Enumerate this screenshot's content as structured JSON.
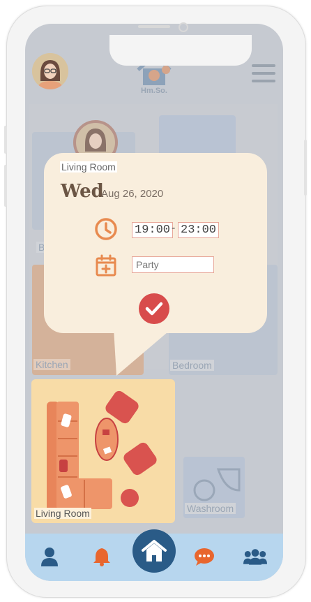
{
  "app": {
    "logo_text": "Hm.So."
  },
  "rooms": [
    {
      "label": "B"
    },
    {
      "label": "Kitchen"
    },
    {
      "label": "Bedroom"
    },
    {
      "label": "Washroom"
    }
  ],
  "living_room": {
    "label": "Living Room"
  },
  "popup": {
    "room": "Living Room",
    "day": "Wed",
    "date": "Aug 26, 2020",
    "start_time": "19:00",
    "time_separator": "-",
    "end_time": "23:00",
    "event_placeholder": "Party"
  },
  "tabbar": {
    "items": [
      {
        "icon": "person-icon"
      },
      {
        "icon": "bell-icon"
      },
      {
        "icon": "home-icon"
      },
      {
        "icon": "chat-icon"
      },
      {
        "icon": "group-icon"
      }
    ]
  },
  "colors": {
    "accent_orange": "#e88a4f",
    "confirm_red": "#d84c4c",
    "home_blue": "#2a5b87",
    "tabbar_bg": "#b7d6ee",
    "popup_bg": "#f9eedd"
  }
}
